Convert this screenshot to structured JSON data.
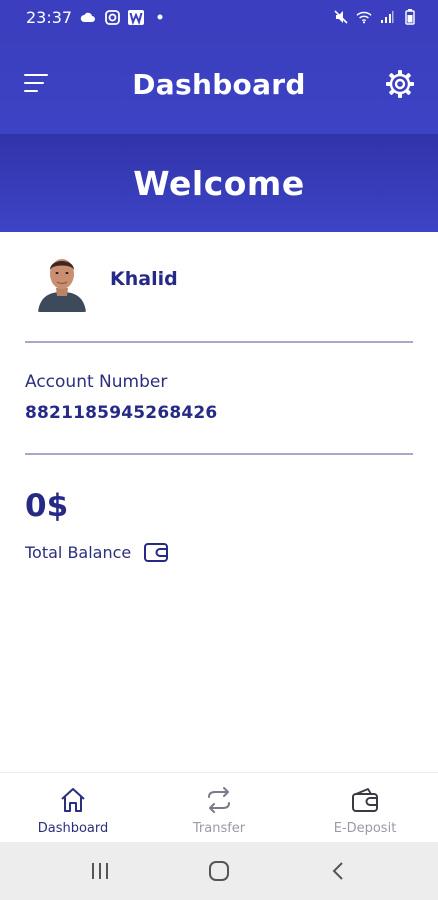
{
  "status_bar": {
    "time": "23:37",
    "left_icons": [
      "cloud-icon",
      "instagram-icon",
      "w-app-icon",
      "dot-icon"
    ],
    "right_icons": [
      "mute-icon",
      "wifi-icon",
      "signal-icon",
      "battery-icon"
    ]
  },
  "app_bar": {
    "title": "Dashboard",
    "menu_icon": "menu-icon",
    "settings_icon": "gear-icon"
  },
  "banner": {
    "text": "Welcome"
  },
  "profile": {
    "name": "Khalid"
  },
  "account": {
    "label": "Account Number",
    "number": "8821185945268426"
  },
  "balance": {
    "amount": "0$",
    "label": "Total Balance",
    "icon": "wallet-icon"
  },
  "bottom_nav": {
    "items": [
      {
        "label": "Dashboard",
        "icon": "home-icon",
        "active": true
      },
      {
        "label": "Transfer",
        "icon": "transfer-icon",
        "active": false
      },
      {
        "label": "E-Deposit",
        "icon": "wallet-icon",
        "active": false
      }
    ]
  },
  "system_nav": {
    "buttons": [
      "recents-icon",
      "home-circle-icon",
      "back-icon"
    ]
  },
  "colors": {
    "primary": "#3b3fbf",
    "text_dark": "#262a86",
    "divider": "#a7a7c6",
    "nav_inactive": "#9a9aa8"
  }
}
